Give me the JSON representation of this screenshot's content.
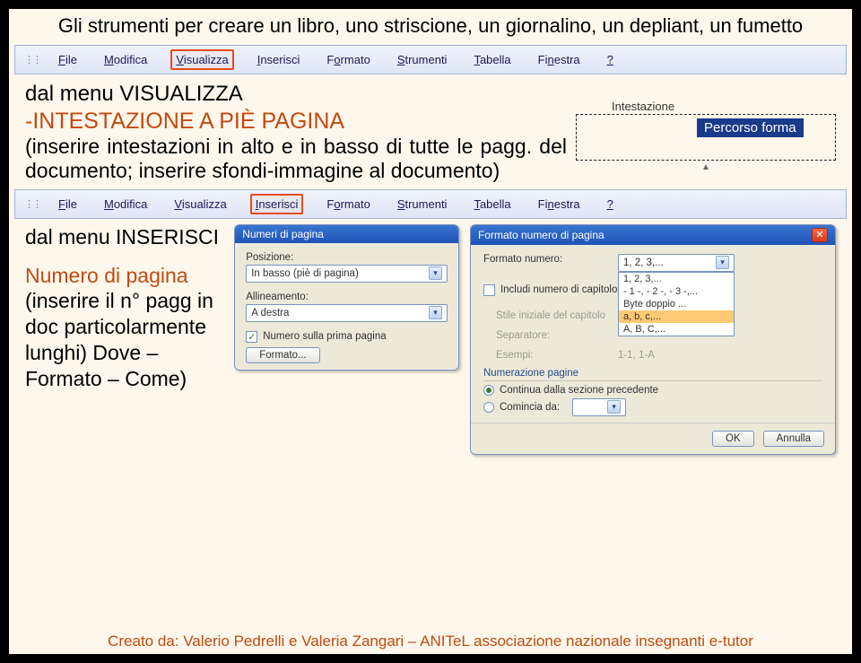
{
  "title": "Gli strumenti per creare un libro, uno striscione, un giornalino, un depliant, un fumetto",
  "menubar": {
    "items": [
      "File",
      "Modifica",
      "Visualizza",
      "Inserisci",
      "Formato",
      "Strumenti",
      "Tabella",
      "Finestra",
      "?"
    ],
    "highlight1_index": 2,
    "highlight2_index": 3
  },
  "section1": {
    "line1": "dal menu VISUALIZZA",
    "line2": "-INTESTAZIONE A PIÈ PAGINA",
    "body": " (inserire intestazioni in alto e in basso di tutte le pagg. del documento; inserire sfondi-immagine al documento)",
    "headerfrag": {
      "label": "Intestazione",
      "selected": "Percorso forma"
    }
  },
  "section2": {
    "header": "dal menu INSERISCI",
    "sub1": "Numero di pagina",
    "sub2": "(inserire il n° pagg in doc particolarmente lunghi) Dove – Formato – Come)"
  },
  "dialog1": {
    "title": "Numeri di pagina",
    "pos_label": "Posizione:",
    "pos_value": "In basso (piè di pagina)",
    "align_label": "Allineamento:",
    "align_value": "A destra",
    "check_label": "Numero sulla prima pagina",
    "checked": true,
    "format_btn": "Formato..."
  },
  "dialog2": {
    "title": "Formato numero di pagina",
    "fmt_label": "Formato numero:",
    "fmt_value": "1, 2, 3,...",
    "list": [
      "1, 2, 3,...",
      "- 1 -, - 2 -, - 3 -,...",
      "Byte doppio ...",
      "a, b, c,...",
      "A, B, C,..."
    ],
    "list_sel_index": 3,
    "include_label": "Includi numero di capitolo",
    "style_label": "Stile iniziale del capitolo",
    "sep_label": "Separatore:",
    "examples_label": "Esempi:",
    "examples_value": "1-1, 1-A",
    "numheader": "Numerazione pagine",
    "radio1": "Continua dalla sezione precedente",
    "radio2": "Comincia da:",
    "ok": "OK",
    "cancel": "Annulla"
  },
  "footer": "Creato da: Valerio Pedrelli e Valeria Zangari – ANITeL associazione nazionale insegnanti e-tutor"
}
